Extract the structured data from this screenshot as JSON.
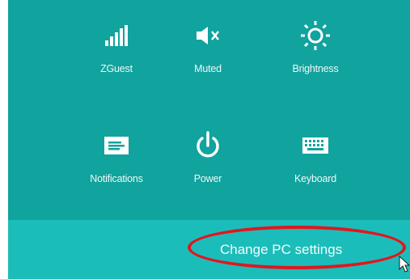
{
  "tiles": [
    {
      "label": "ZGuest",
      "icon": "wifi-signal-icon"
    },
    {
      "label": "Muted",
      "icon": "speaker-muted-icon"
    },
    {
      "label": "Brightness",
      "icon": "brightness-icon"
    },
    {
      "label": "Notifications",
      "icon": "notifications-icon"
    },
    {
      "label": "Power",
      "icon": "power-icon"
    },
    {
      "label": "Keyboard",
      "icon": "keyboard-icon"
    }
  ],
  "footer": {
    "change_pc_settings_label": "Change PC settings"
  },
  "colors": {
    "panel": "#11a39e",
    "footer": "#1bbdba",
    "annotation": "#e3151f",
    "text": "#eef8f7"
  }
}
